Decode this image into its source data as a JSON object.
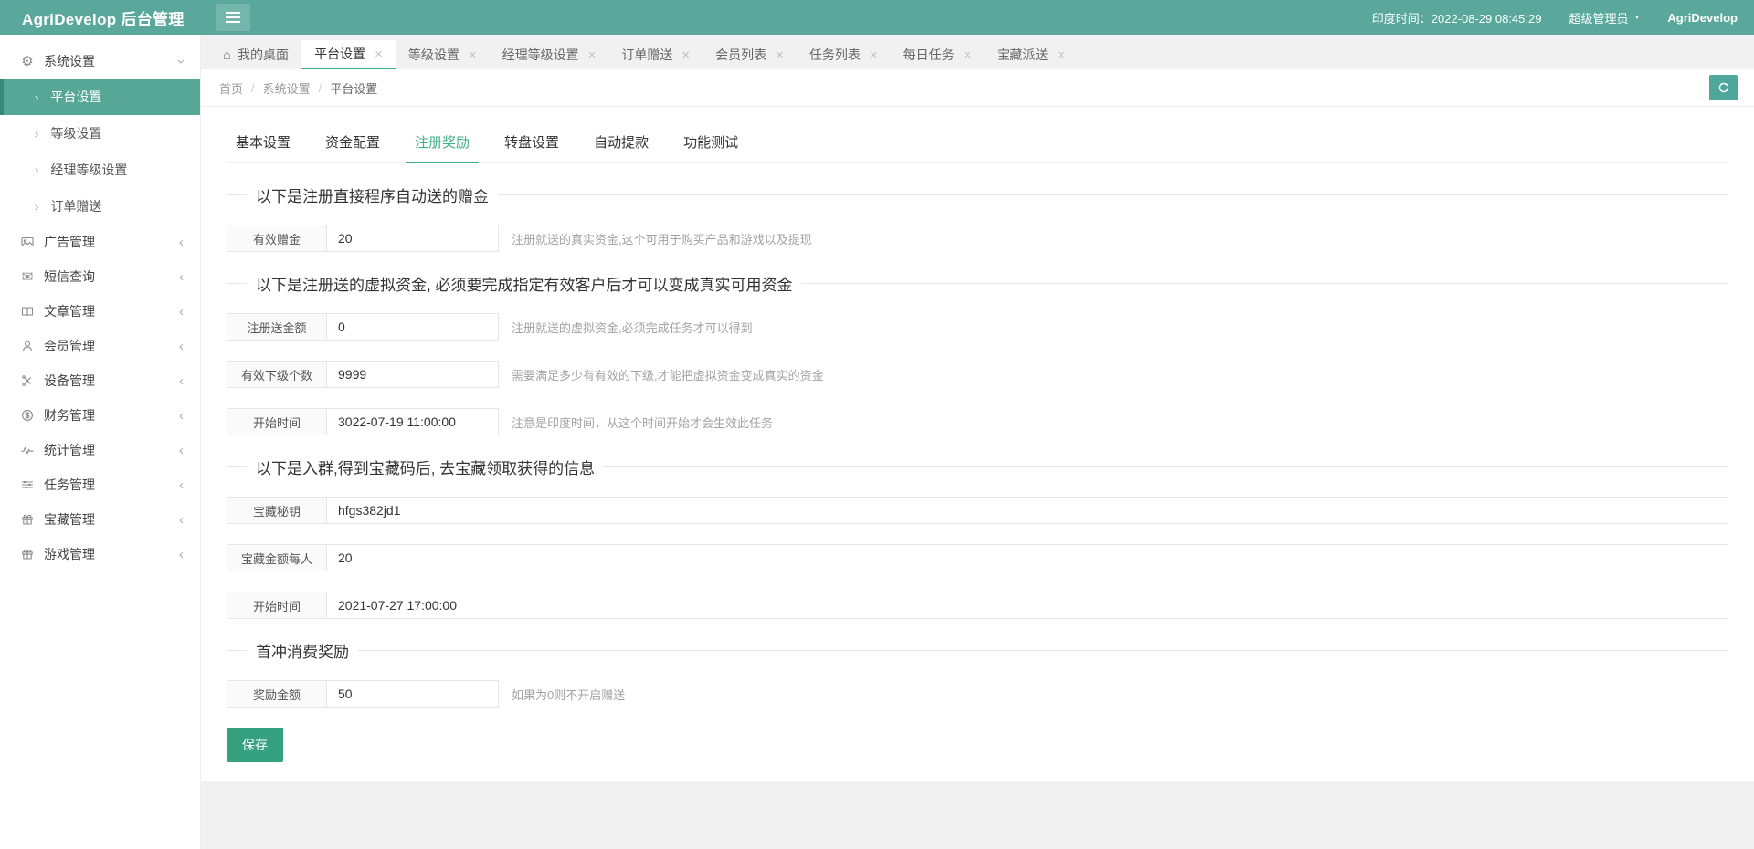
{
  "colors": {
    "header_teal": "#5aa89c",
    "active_item_teal": "#57a797",
    "accent_green": "#3fae82",
    "save_button_green": "#35a17e",
    "refresh_button_teal": "#4ea79a"
  },
  "header": {
    "brand": "AgriDevelop 后台管理",
    "time": "印度时间：2022-08-29 08:45:29",
    "role": "超级管理员",
    "username": "AgriDevelop"
  },
  "sidebar": {
    "items": [
      {
        "id": "system-settings",
        "label": "系统设置",
        "icon": "gear-icon",
        "expanded": true,
        "children": [
          {
            "id": "platform-settings",
            "label": "平台设置",
            "active": true
          },
          {
            "id": "level-settings",
            "label": "等级设置",
            "active": false
          },
          {
            "id": "manager-level-settings",
            "label": "经理等级设置",
            "active": false
          },
          {
            "id": "order-gift",
            "label": "订单赠送",
            "active": false
          }
        ]
      },
      {
        "id": "ad-management",
        "label": "广告管理",
        "icon": "image-icon"
      },
      {
        "id": "sms-query",
        "label": "短信查询",
        "icon": "mail-icon"
      },
      {
        "id": "article-management",
        "label": "文章管理",
        "icon": "book-icon"
      },
      {
        "id": "member-management",
        "label": "会员管理",
        "icon": "user-icon"
      },
      {
        "id": "device-management",
        "label": "设备管理",
        "icon": "tools-icon"
      },
      {
        "id": "finance-management",
        "label": "财务管理",
        "icon": "dollar-icon"
      },
      {
        "id": "stats-management",
        "label": "统计管理",
        "icon": "pulse-icon"
      },
      {
        "id": "task-management",
        "label": "任务管理",
        "icon": "sliders-icon"
      },
      {
        "id": "treasure-management",
        "label": "宝藏管理",
        "icon": "gift-icon"
      },
      {
        "id": "game-management",
        "label": "游戏管理",
        "icon": "gift-icon"
      }
    ]
  },
  "tabbar": {
    "home": {
      "id": "my-desktop",
      "label": "我的桌面",
      "icon": "home-icon"
    },
    "close_glyph": "×",
    "tabs": [
      {
        "id": "platform-settings",
        "label": "平台设置",
        "active": true
      },
      {
        "id": "level-settings",
        "label": "等级设置",
        "active": false
      },
      {
        "id": "manager-level-settings",
        "label": "经理等级设置",
        "active": false
      },
      {
        "id": "order-gift",
        "label": "订单赠送",
        "active": false
      },
      {
        "id": "member-list",
        "label": "会员列表",
        "active": false
      },
      {
        "id": "task-list",
        "label": "任务列表",
        "active": false
      },
      {
        "id": "daily-task",
        "label": "每日任务",
        "active": false
      },
      {
        "id": "treasure-dispatch",
        "label": "宝藏派送",
        "active": false
      }
    ]
  },
  "breadcrumb": {
    "separator": "/",
    "items": [
      "首页",
      "系统设置",
      "平台设置"
    ]
  },
  "form": {
    "tabs": [
      {
        "id": "basic-settings",
        "label": "基本设置",
        "active": false
      },
      {
        "id": "fund-config",
        "label": "资金配置",
        "active": false
      },
      {
        "id": "register-reward",
        "label": "注册奖励",
        "active": true
      },
      {
        "id": "wheel-settings",
        "label": "转盘设置",
        "active": false
      },
      {
        "id": "auto-withdraw",
        "label": "自动提款",
        "active": false
      },
      {
        "id": "function-test",
        "label": "功能测试",
        "active": false
      }
    ],
    "sections": [
      {
        "title": "以下是注册直接程序自动送的赠金",
        "fields": [
          {
            "id": "valid-bonus",
            "label": "有效赠金",
            "value": "20",
            "hint": "注册就送的真实资金,这个可用于购买产品和游戏以及提现",
            "wide": false
          }
        ]
      },
      {
        "title": "以下是注册送的虚拟资金, 必须要完成指定有效客户后才可以变成真实可用资金",
        "fields": [
          {
            "id": "register-gift-amount",
            "label": "注册送金额",
            "value": "0",
            "hint": "注册就送的虚拟资金,必须完成任务才可以得到",
            "wide": false
          },
          {
            "id": "valid-subordinate-count",
            "label": "有效下级个数",
            "value": "9999",
            "hint": "需要满足多少有有效的下级,才能把虚拟资金变成真实的资金",
            "wide": false
          },
          {
            "id": "virtual-start-time",
            "label": "开始时间",
            "value": "3022-07-19 11:00:00",
            "hint": "注意是印度时间，从这个时间开始才会生效此任务",
            "wide": false
          }
        ]
      },
      {
        "title": "以下是入群,得到宝藏码后, 去宝藏领取获得的信息",
        "fields": [
          {
            "id": "treasure-secret-key",
            "label": "宝藏秘钥",
            "value": "hfgs382jd1",
            "hint": "",
            "wide": true
          },
          {
            "id": "treasure-amount-per-person",
            "label": "宝藏金额每人",
            "value": "20",
            "hint": "",
            "wide": true
          },
          {
            "id": "treasure-start-time",
            "label": "开始时间",
            "value": "2021-07-27 17:00:00",
            "hint": "",
            "wide": true
          }
        ]
      },
      {
        "title": "首冲消费奖励",
        "fields": [
          {
            "id": "reward-amount",
            "label": "奖励金额",
            "value": "50",
            "hint": "如果为0则不开启赠送",
            "wide": false
          }
        ]
      }
    ],
    "save_label": "保存"
  }
}
